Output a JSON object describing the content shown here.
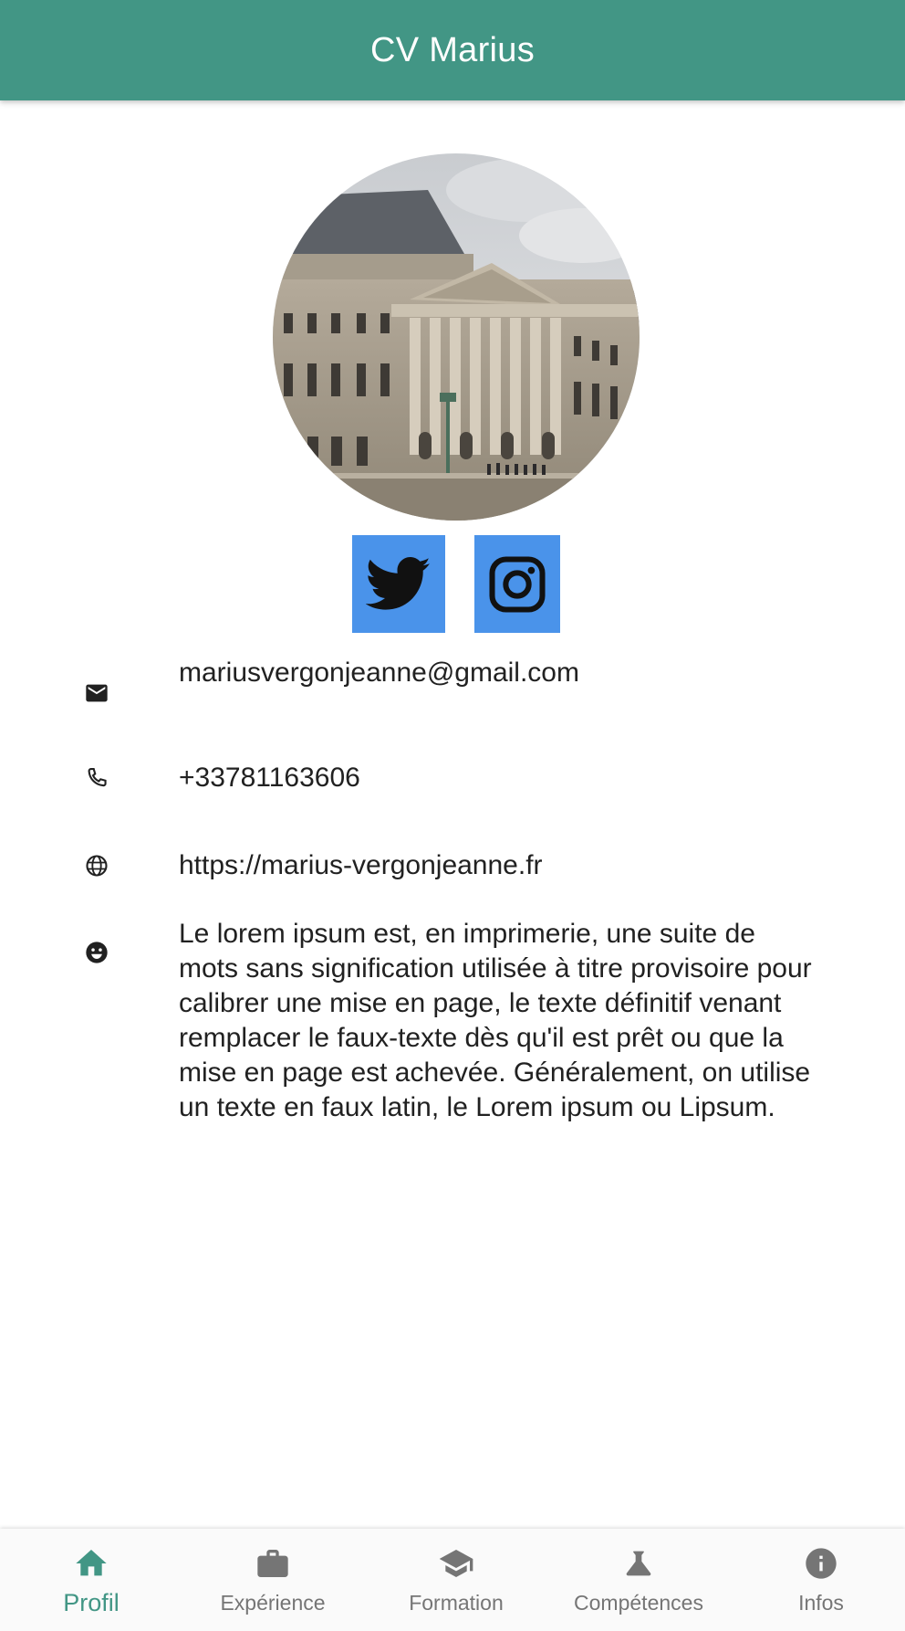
{
  "app_bar": {
    "title": "CV Marius"
  },
  "profile": {
    "avatar_icon": "building-photo",
    "social": [
      {
        "name": "Twitter",
        "icon": "twitter-bird-icon"
      },
      {
        "name": "Instagram",
        "icon": "instagram-camera-icon"
      }
    ]
  },
  "contact": {
    "email": "mariusvergonjeanne@gmail.com",
    "email_icon": "mail-icon",
    "phone": "+33781163606",
    "phone_icon": "phone-icon",
    "website": "https://marius-vergonjeanne.fr",
    "website_icon": "globe-icon",
    "bio": "Le lorem ipsum est, en imprimerie, une suite de mots sans signification utilisée à titre provisoire pour calibrer une mise en page, le texte définitif venant remplacer le faux-texte dès qu'il est prêt ou que la mise en page est achevée. Généralement, on utilise un texte en faux latin, le Lorem ipsum ou Lipsum.",
    "bio_icon": "smiley-icon"
  },
  "bottom_nav": {
    "active_index": 0,
    "items": [
      {
        "label": "Profil",
        "icon": "home-icon"
      },
      {
        "label": "Expérience",
        "icon": "briefcase-icon"
      },
      {
        "label": "Formation",
        "icon": "graduation-cap-icon"
      },
      {
        "label": "Compétences",
        "icon": "flask-icon"
      },
      {
        "label": "Infos",
        "icon": "info-icon"
      }
    ]
  },
  "colors": {
    "primary": "#429685",
    "social_button": "#4a93ea",
    "nav_inactive": "#757575"
  }
}
